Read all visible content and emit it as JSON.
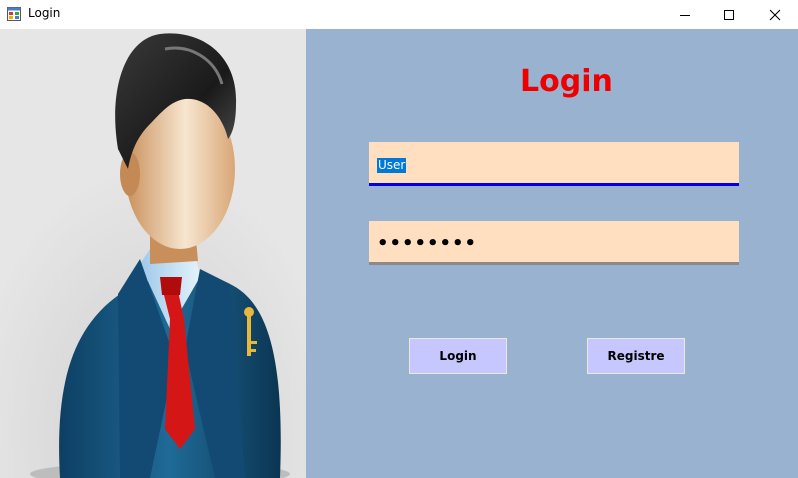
{
  "window": {
    "title": "Login",
    "controls": {
      "minimize": "minimize-icon",
      "maximize": "maximize-icon",
      "close": "close-icon"
    }
  },
  "form": {
    "heading": "Login",
    "username_value": "User",
    "password_value": "••••••••",
    "login_button": "Login",
    "register_button": "Registre"
  },
  "colors": {
    "heading": "#ee0000",
    "panel": "#98b2cf",
    "field": "#ffdfc0",
    "button": "#c7c7ff",
    "focus_underline": "#0000e6"
  }
}
